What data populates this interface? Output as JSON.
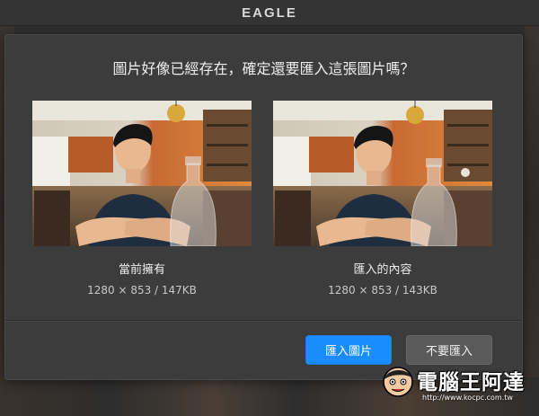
{
  "app": {
    "title": "EAGLE"
  },
  "dialog": {
    "question": "圖片好像已經存在，確定還要匯入這張圖片嗎？",
    "existing": {
      "label": "當前擁有",
      "info": "1280 × 853 / 147KB"
    },
    "incoming": {
      "label": "匯入的內容",
      "info": "1280 × 853 / 143KB"
    },
    "buttons": {
      "import_label": "匯入圖片",
      "cancel_label": "不要匯入"
    }
  },
  "watermark": {
    "name": "電腦王阿達",
    "url": "http://www.kocpc.com.tw"
  },
  "colors": {
    "primary": "#1a8cff",
    "secondary_button": "#5a5a5a",
    "dialog_bg": "#3c3c3c",
    "topbar_bg": "#343434"
  },
  "icons": {
    "photo_existing": "photo-thumbnail",
    "photo_incoming": "photo-thumbnail",
    "watermark_logo": "cartoon-face-logo"
  }
}
